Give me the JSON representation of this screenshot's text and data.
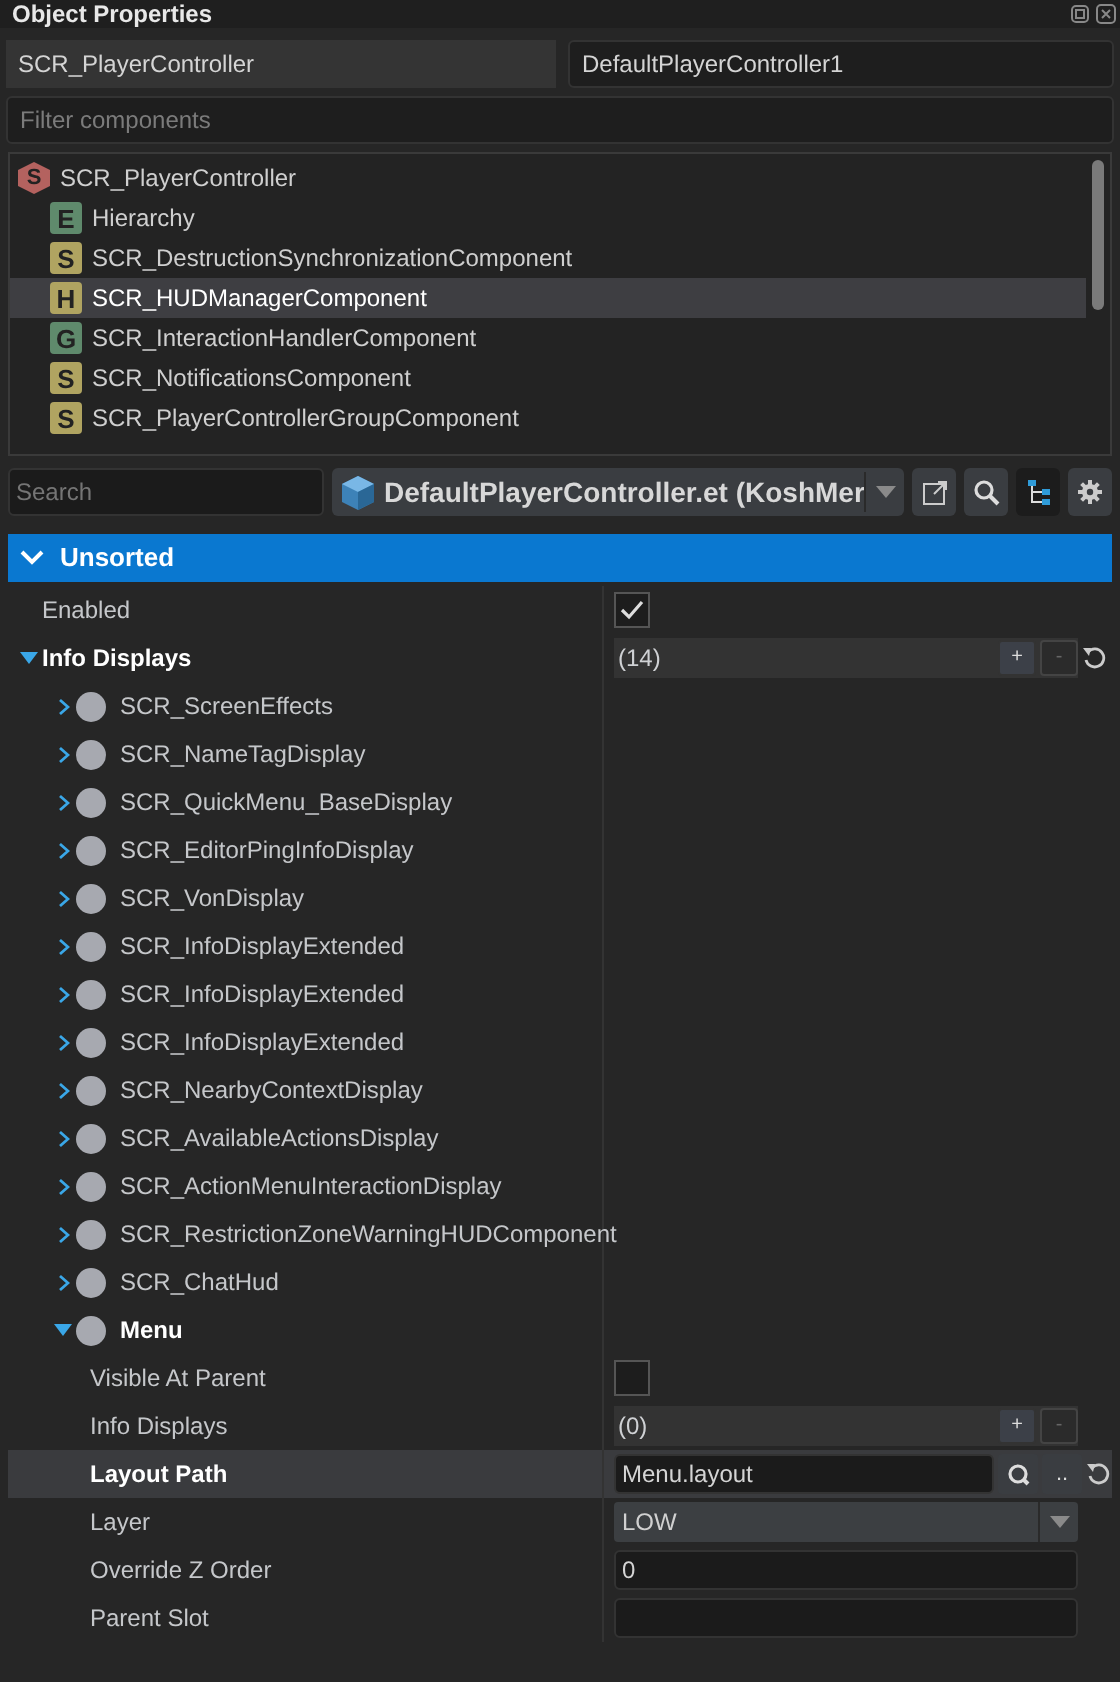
{
  "panel": {
    "title": "Object Properties"
  },
  "entity": {
    "class": "SCR_PlayerController",
    "name": "DefaultPlayerController1"
  },
  "filter": {
    "placeholder": "Filter components"
  },
  "components": [
    {
      "label": "SCR_PlayerController",
      "letter": "S",
      "color": "#b4625f",
      "kind": "root",
      "selected": false
    },
    {
      "label": "Hierarchy",
      "letter": "E",
      "color": "#5f8a6c",
      "kind": "child",
      "selected": false
    },
    {
      "label": "SCR_DestructionSynchronizationComponent",
      "letter": "S",
      "color": "#b0a461",
      "kind": "child",
      "selected": false
    },
    {
      "label": "SCR_HUDManagerComponent",
      "letter": "H",
      "color": "#b0a461",
      "kind": "child",
      "selected": true
    },
    {
      "label": "SCR_InteractionHandlerComponent",
      "letter": "G",
      "color": "#5f8a6c",
      "kind": "child",
      "selected": false
    },
    {
      "label": "SCR_NotificationsComponent",
      "letter": "S",
      "color": "#b0a461",
      "kind": "child",
      "selected": false
    },
    {
      "label": "SCR_PlayerControllerGroupComponent",
      "letter": "S",
      "color": "#b0a461",
      "kind": "child",
      "selected": false
    }
  ],
  "search": {
    "placeholder": "Search"
  },
  "prefab": {
    "label": "DefaultPlayerController.et (KoshMer"
  },
  "toolbar": [
    {
      "kind": "open",
      "selected": false
    },
    {
      "kind": "search",
      "selected": false
    },
    {
      "kind": "hierarchy",
      "selected": true
    },
    {
      "kind": "settings",
      "selected": false
    }
  ],
  "section": {
    "title": "Unsorted",
    "expanded": true
  },
  "properties": [
    {
      "kind": "checkbox",
      "label": "Enabled",
      "checked": true,
      "modified": false,
      "selected": false
    },
    {
      "kind": "array",
      "label": "Info Displays",
      "value": "(14)",
      "add": "+",
      "remove": "-",
      "modified": true,
      "expanded": true,
      "selected": false,
      "children": [
        {
          "kind": "item",
          "label": "SCR_ScreenEffects",
          "expanded": false,
          "modified": false,
          "selected": false
        },
        {
          "kind": "item",
          "label": "SCR_NameTagDisplay",
          "expanded": false,
          "modified": false,
          "selected": false
        },
        {
          "kind": "item",
          "label": "SCR_QuickMenu_BaseDisplay",
          "expanded": false,
          "modified": false,
          "selected": false
        },
        {
          "kind": "item",
          "label": "SCR_EditorPingInfoDisplay",
          "expanded": false,
          "modified": false,
          "selected": false
        },
        {
          "kind": "item",
          "label": "SCR_VonDisplay",
          "expanded": false,
          "modified": false,
          "selected": false
        },
        {
          "kind": "item",
          "label": "SCR_InfoDisplayExtended",
          "expanded": false,
          "modified": false,
          "selected": false
        },
        {
          "kind": "item",
          "label": "SCR_InfoDisplayExtended",
          "expanded": false,
          "modified": false,
          "selected": false
        },
        {
          "kind": "item",
          "label": "SCR_InfoDisplayExtended",
          "expanded": false,
          "modified": false,
          "selected": false
        },
        {
          "kind": "item",
          "label": "SCR_NearbyContextDisplay",
          "expanded": false,
          "modified": false,
          "selected": false
        },
        {
          "kind": "item",
          "label": "SCR_AvailableActionsDisplay",
          "expanded": false,
          "modified": false,
          "selected": false
        },
        {
          "kind": "item",
          "label": "SCR_ActionMenuInteractionDisplay",
          "expanded": false,
          "modified": false,
          "selected": false
        },
        {
          "kind": "item",
          "label": "SCR_RestrictionZoneWarningHUDComponent",
          "expanded": false,
          "modified": false,
          "selected": false
        },
        {
          "kind": "item",
          "label": "SCR_ChatHud",
          "expanded": false,
          "modified": false,
          "selected": false
        },
        {
          "kind": "item",
          "label": "Menu",
          "expanded": true,
          "modified": true,
          "selected": false,
          "children": [
            {
              "kind": "checkbox",
              "label": "Visible At Parent",
              "checked": false,
              "modified": false,
              "selected": false
            },
            {
              "kind": "array",
              "label": "Info Displays",
              "value": "(0)",
              "add": "+",
              "remove": "-",
              "modified": false,
              "selected": false
            },
            {
              "kind": "path",
              "label": "Layout Path",
              "value": "Menu.layout",
              "browse": "..",
              "modified": true,
              "selected": true
            },
            {
              "kind": "dropdown",
              "label": "Layer",
              "value": "LOW",
              "modified": false,
              "selected": false
            },
            {
              "kind": "input",
              "label": "Override Z Order",
              "value": "0",
              "modified": false,
              "selected": false
            },
            {
              "kind": "input",
              "label": "Parent Slot",
              "modified": false,
              "selected": false
            }
          ]
        }
      ]
    }
  ]
}
